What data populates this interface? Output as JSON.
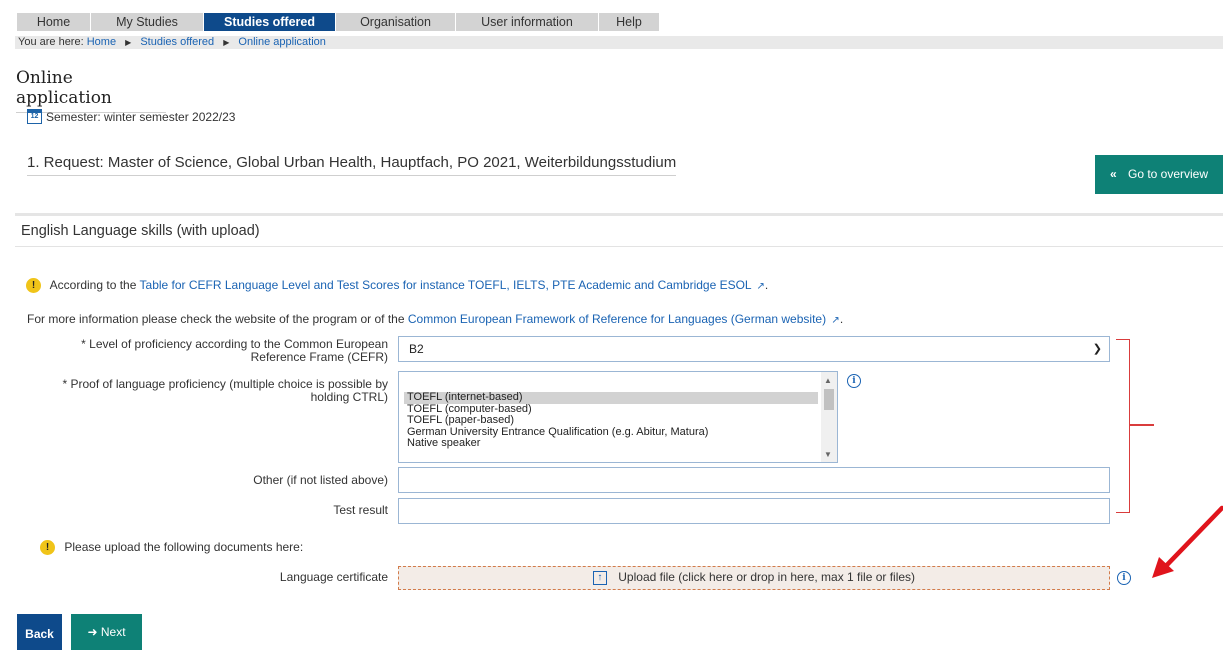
{
  "nav": {
    "tabs": [
      {
        "label": "Home"
      },
      {
        "label": "My Studies"
      },
      {
        "label": "Studies offered"
      },
      {
        "label": "Organisation"
      },
      {
        "label": "User information"
      },
      {
        "label": "Help"
      }
    ],
    "active_tab": "Studies offered"
  },
  "breadcrumb": {
    "prefix": "You are here:",
    "items": [
      "Home",
      "Studies offered",
      "Online application"
    ]
  },
  "page": {
    "title": "Online application",
    "semester": "Semester: winter semester 2022/23",
    "calendar_day": "12",
    "request_title": "1. Request: Master of Science, Global Urban Health, Hauptfach, PO 2021, Weiterbildungsstudium",
    "overview_button": "Go to overview"
  },
  "section": {
    "title": "English Language skills (with upload)",
    "info_prefix": "According to the",
    "info_link": "Table for CEFR Language Level and Test Scores for instance TOEFL, IELTS, PTE Academic and Cambridge ESOL",
    "info_suffix": ".",
    "more_prefix": "For more information please check the website of the program or of the",
    "more_link": "Common European Framework of Reference for Languages (German website)",
    "more_suffix": "."
  },
  "form": {
    "level_label_1": "* Level of proficiency according to the Common European",
    "level_label_2": "Reference Frame (CEFR)",
    "level_value": "B2",
    "proof_label_1": "* Proof of language proficiency (multiple choice is possible by",
    "proof_label_2": "holding CTRL)",
    "proof_options": [
      "TOEFL (internet-based)",
      "TOEFL (computer-based)",
      "TOEFL (paper-based)",
      "German University Entrance Qualification (e.g. Abitur, Matura)",
      "Native speaker"
    ],
    "proof_selected": "TOEFL (internet-based)",
    "other_label": "Other (if not listed above)",
    "other_value": "",
    "test_label": "Test result",
    "test_value": "",
    "upload_notice": "Please upload the following documents here:",
    "certificate_label": "Language certificate",
    "upload_text": "Upload file (click here or drop in here, max 1 file or files)"
  },
  "buttons": {
    "back": "Back",
    "next": "Next"
  },
  "colors": {
    "nav_active": "#0e4a8b",
    "teal_button": "#0e8176",
    "link": "#1a63b3",
    "annotation_red": "#d93c3c"
  }
}
